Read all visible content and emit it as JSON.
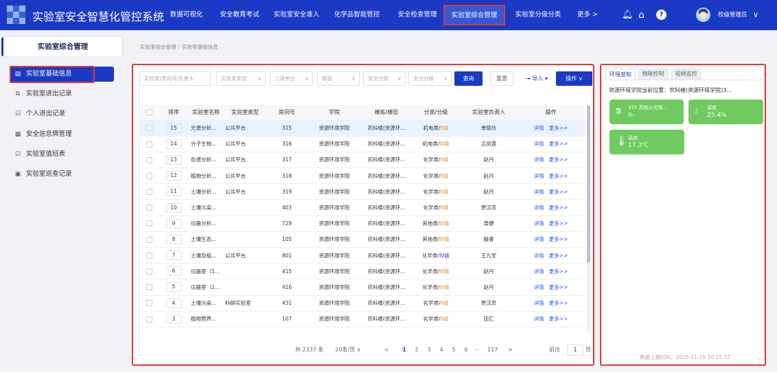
{
  "app": {
    "title": "实验室安全智慧化管控系统"
  },
  "nav": [
    {
      "label": "数据可视化",
      "active": false
    },
    {
      "label": "安全教育考试",
      "active": false
    },
    {
      "label": "实验室安全准入",
      "active": false
    },
    {
      "label": "化学品智能管控",
      "active": false
    },
    {
      "label": "安全检查管理",
      "active": false
    },
    {
      "label": "实验室综合管理",
      "active": true
    },
    {
      "label": "实验室分级分类",
      "active": false
    },
    {
      "label": "更多 >",
      "active": false
    }
  ],
  "user": {
    "name": "校级管理员"
  },
  "sidebar": {
    "title": "实验室综合管理",
    "items": [
      {
        "label": "实验室基础信息",
        "icon": "document-icon",
        "active": true
      },
      {
        "label": "实验室进出记录",
        "icon": "log-icon",
        "active": false
      },
      {
        "label": "个人进出记录",
        "icon": "person-log-icon",
        "active": false
      },
      {
        "label": "安全信息牌管理",
        "icon": "signboard-icon",
        "active": false
      },
      {
        "label": "实验室值班表",
        "icon": "schedule-icon",
        "active": false
      },
      {
        "label": "实验室巡查记录",
        "icon": "patrol-icon",
        "active": false
      }
    ]
  },
  "breadcrumb": [
    "实验室综合管理",
    "实验室基础信息"
  ],
  "filters": {
    "search_placeholder": "实验室/房间号/负责人",
    "type_placeholder": "实验室类型",
    "unit_placeholder": "二级单位",
    "building_placeholder": "楼栋",
    "category_placeholder": "安全分类",
    "level_placeholder": "安全分级",
    "query_label": "查询",
    "reset_label": "重置",
    "import_label": "导入",
    "ops_label": "操作"
  },
  "table": {
    "columns": [
      "排序",
      "实验室名称",
      "实验室类型",
      "房间号",
      "学院",
      "楼栋/楼层",
      "分类/分级",
      "实验室负责人",
      "操作"
    ],
    "detail_label": "详情",
    "more_label": "更多>>",
    "rows": [
      {
        "idx": "15",
        "name": "光谱分析...",
        "type": "公共平台",
        "room": "315",
        "college": "资源环境学院",
        "building": "农科楼(资源环...",
        "category": "机电类/",
        "level": "II级",
        "manager": "单晓玲",
        "selected": true
      },
      {
        "idx": "14",
        "name": "分子生物...",
        "type": "公共平台",
        "room": "316",
        "college": "资源环境学院",
        "building": "农科楼(资源环...",
        "category": "机电类/",
        "level": "III级",
        "manager": "吕凤莲",
        "selected": false
      },
      {
        "idx": "13",
        "name": "色谱分析...",
        "type": "公共平台",
        "room": "317",
        "college": "资源环境学院",
        "building": "农科楼(资源环...",
        "category": "化学类/",
        "level": "II级",
        "manager": "赵丹",
        "selected": false
      },
      {
        "idx": "12",
        "name": "植物分析...",
        "type": "公共平台",
        "room": "318",
        "college": "资源环境学院",
        "building": "农科楼(资源环...",
        "category": "化学类/",
        "level": "II级",
        "manager": "赵丹",
        "selected": false
      },
      {
        "idx": "11",
        "name": "土壤分析...",
        "type": "公共平台",
        "room": "319",
        "college": "资源环境学院",
        "building": "农科楼(资源环...",
        "category": "化学类/",
        "level": "II级",
        "manager": "赵丹",
        "selected": false
      },
      {
        "idx": "10",
        "name": "土壤污染...",
        "type": "",
        "room": "403",
        "college": "资源环境学院",
        "building": "农科楼(资源环...",
        "category": "化学类/",
        "level": "II级",
        "manager": "贾汉忠",
        "selected": false
      },
      {
        "idx": "9",
        "name": "仪器分析...",
        "type": "",
        "room": "729",
        "college": "资源环境学院",
        "building": "农科楼(资源环...",
        "category": "其他类/",
        "level": "III级",
        "manager": "周健",
        "selected": false
      },
      {
        "idx": "8",
        "name": "土壤生态...",
        "type": "",
        "room": "105",
        "college": "资源环境学院",
        "building": "农科楼(资源环...",
        "category": "其他类/",
        "level": "III级",
        "manager": "殷睿",
        "selected": false
      },
      {
        "idx": "7",
        "name": "土壤及植...",
        "type": "公共平台",
        "room": "801",
        "college": "资源环境学院",
        "building": "农科楼(资源环...",
        "category": "化学类/",
        "level": "IV级",
        "manager": "王九军",
        "selected": false
      },
      {
        "idx": "6",
        "name": "仪器室（1...",
        "type": "",
        "room": "415",
        "college": "资源环境学院",
        "building": "农科楼(资源环...",
        "category": "化学类/",
        "level": "III级",
        "manager": "赵丹",
        "selected": false
      },
      {
        "idx": "5",
        "name": "仪器室（2...",
        "type": "",
        "room": "416",
        "college": "资源环境学院",
        "building": "农科楼(资源环...",
        "category": "化学类/",
        "level": "III级",
        "manager": "赵丹",
        "selected": false
      },
      {
        "idx": "4",
        "name": "土壤污染...",
        "type": "科研实验室",
        "room": "431",
        "college": "资源环境学院",
        "building": "农科楼(资源环...",
        "category": "化学类/",
        "level": "II级",
        "manager": "贾汉忠",
        "selected": false
      },
      {
        "idx": "3",
        "name": "植物营养...",
        "type": "",
        "room": "107",
        "college": "资源环境学院",
        "building": "农科楼(资源环...",
        "category": "化学类/",
        "level": "II级",
        "manager": "田汇",
        "selected": false
      }
    ]
  },
  "pagination": {
    "total": "共 2337 条",
    "page_size": "20条/页",
    "prev": "<",
    "pages": [
      "1",
      "2",
      "3",
      "4",
      "5",
      "6"
    ],
    "current": "1",
    "ellipsis": "···",
    "last": "117",
    "next": ">",
    "jump_label": "前往",
    "jump_value": "1",
    "page_unit": "页"
  },
  "right_panel": {
    "tabs": [
      {
        "label": "环境感知",
        "active": true
      },
      {
        "label": "物联控制",
        "active": false
      },
      {
        "label": "视频监控",
        "active": false
      }
    ],
    "current_location": "资源环境学院当前位置：农科楼(资源环境学院)3...",
    "cards": [
      {
        "label": "315 高频火灾探...",
        "value": "0-",
        "icon": "fire-detector-icon"
      },
      {
        "label": "湿度",
        "value": "25.4%",
        "icon": "humidity-icon"
      },
      {
        "label": "温度",
        "value": "17.3℃",
        "icon": "thermometer-icon"
      }
    ],
    "report_time": "数据上报时间：2025-11-25 10:15:32"
  },
  "colors": {
    "primary": "#1a39c4",
    "highlight_border": "#e0392f",
    "card_green": "#6fca5f",
    "level_orange": "#f08c1e"
  }
}
